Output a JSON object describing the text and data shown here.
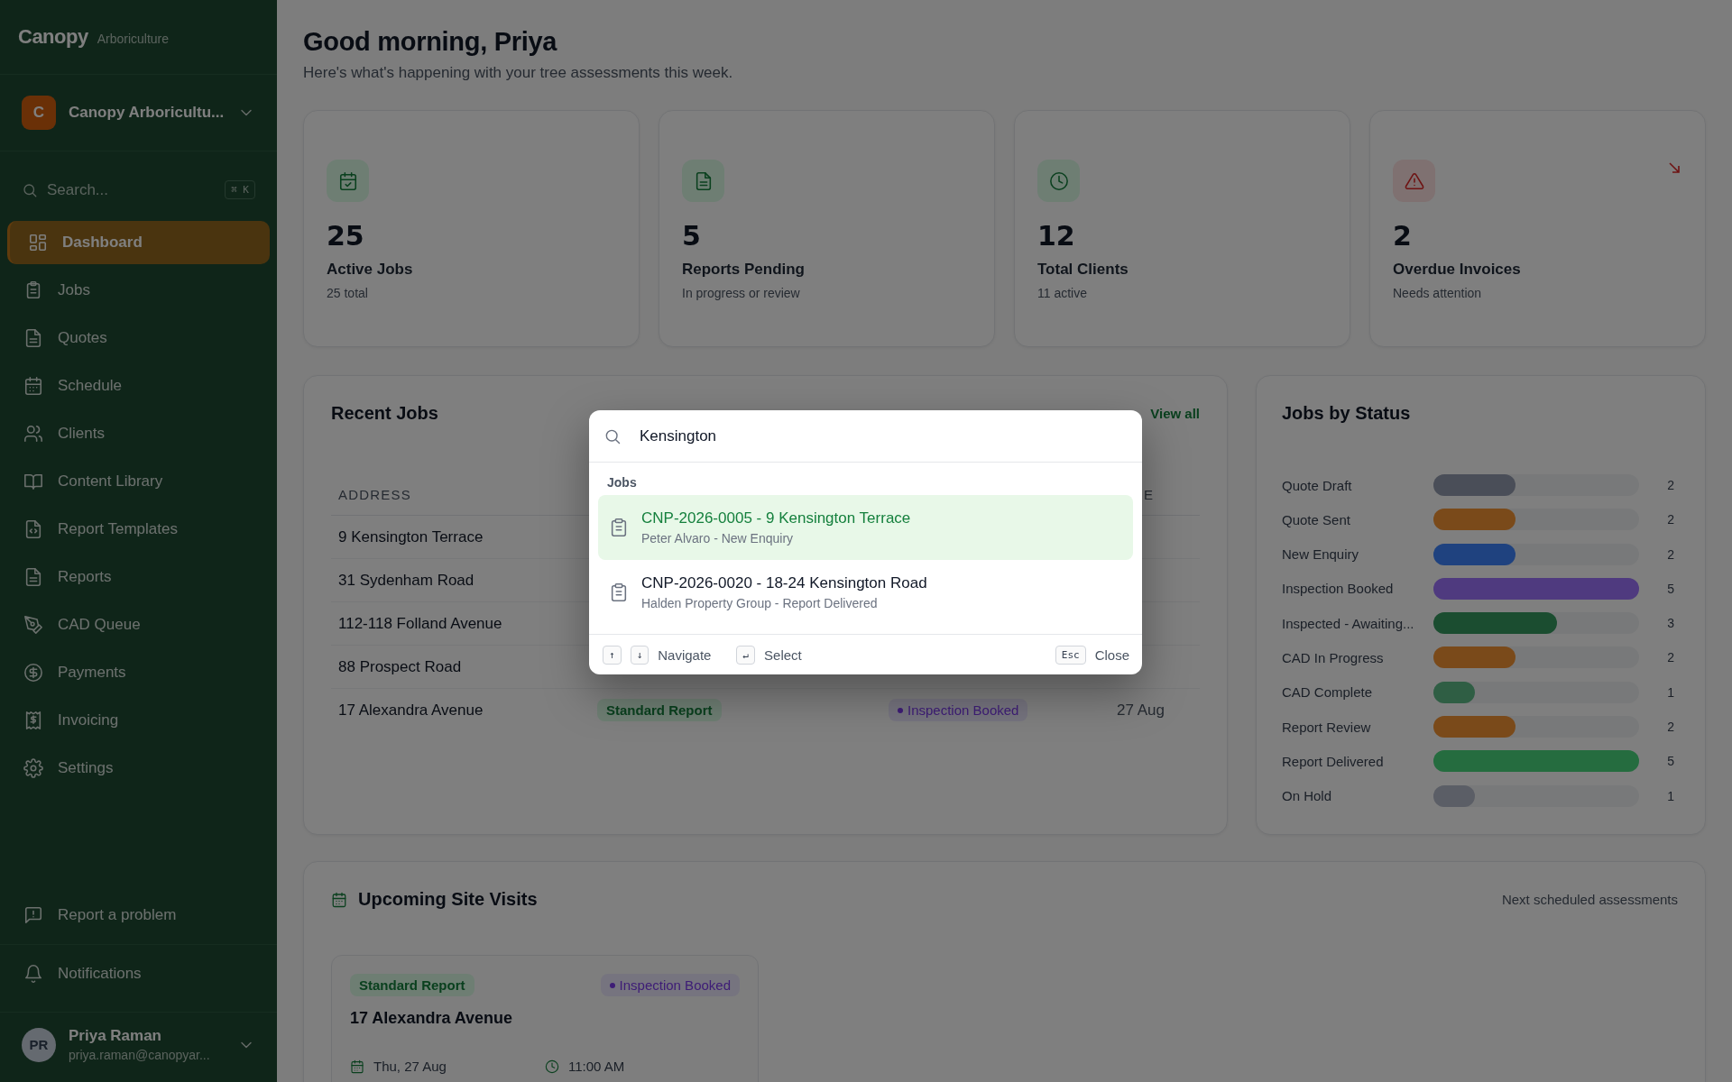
{
  "sidebar": {
    "brand": "Canopy",
    "brand_sub": "Arboriculture",
    "org": {
      "initial": "C",
      "name": "Canopy Arboricultu..."
    },
    "search": {
      "placeholder": "Search...",
      "shortcut": "⌘ K"
    },
    "items": [
      {
        "label": "Dashboard",
        "selected": true
      },
      {
        "label": "Jobs",
        "selected": false
      },
      {
        "label": "Quotes",
        "selected": false
      },
      {
        "label": "Schedule",
        "selected": false
      },
      {
        "label": "Clients",
        "selected": false
      },
      {
        "label": "Content Library",
        "selected": false
      },
      {
        "label": "Report Templates",
        "selected": false
      },
      {
        "label": "Reports",
        "selected": false
      },
      {
        "label": "CAD Queue",
        "selected": false
      },
      {
        "label": "Payments",
        "selected": false
      },
      {
        "label": "Invoicing",
        "selected": false
      },
      {
        "label": "Settings",
        "selected": false
      }
    ],
    "footer_items": [
      {
        "label": "Report a problem"
      },
      {
        "label": "Notifications"
      }
    ],
    "user": {
      "initials": "PR",
      "name": "Priya Raman",
      "email": "priya.raman@canopyar..."
    }
  },
  "header": {
    "title": "Good morning, Priya",
    "subtitle": "Here's what's happening with your tree assessments this week."
  },
  "stats": [
    {
      "kind": "normal",
      "value": "25",
      "label": "Active Jobs",
      "note": "25 total"
    },
    {
      "kind": "normal",
      "value": "5",
      "label": "Reports Pending",
      "note": "In progress or review"
    },
    {
      "kind": "normal",
      "value": "12",
      "label": "Total Clients",
      "note": "11 active"
    },
    {
      "kind": "alert",
      "value": "2",
      "label": "Overdue Invoices",
      "note": "Needs attention"
    }
  ],
  "recent_jobs": {
    "title": "Recent Jobs",
    "link": "View all",
    "columns": [
      "ADDRESS",
      "E"
    ],
    "rows": [
      {
        "address": "9 Kensington Terrace"
      },
      {
        "address": "31 Sydenham Road"
      },
      {
        "address": "112-118 Folland Avenue"
      },
      {
        "address": "88 Prospect Road"
      },
      {
        "address": "17 Alexandra Avenue",
        "type": "Standard Report",
        "status": "Inspection Booked",
        "date": "27 Aug"
      }
    ]
  },
  "jobs_by_status": {
    "title": "Jobs by Status",
    "rows": [
      {
        "label": "Quote Draft",
        "count": "2",
        "level": 0.4,
        "color": "#4a4e58"
      },
      {
        "label": "Quote Sent",
        "count": "2",
        "level": 0.4,
        "color": "#7a4a1a"
      },
      {
        "label": "New Enquiry",
        "count": "2",
        "level": 0.4,
        "color": "#1f427f"
      },
      {
        "label": "Inspection Booked",
        "count": "5",
        "level": 1,
        "color": "#4f3a86"
      },
      {
        "label": "Inspected - Awaiting...",
        "count": "3",
        "level": 0.6,
        "color": "#1b4d30"
      },
      {
        "label": "CAD In Progress",
        "count": "2",
        "level": 0.4,
        "color": "#7a4a1a"
      },
      {
        "label": "CAD Complete",
        "count": "1",
        "level": 0.2,
        "color": "#2f5e44"
      },
      {
        "label": "Report Review",
        "count": "2",
        "level": 0.4,
        "color": "#7a4a1a"
      },
      {
        "label": "Report Delivered",
        "count": "5",
        "level": 1,
        "color": "#256c3f"
      },
      {
        "label": "On Hold",
        "count": "1",
        "level": 0.2,
        "color": "#5b5e66"
      }
    ]
  },
  "upcoming": {
    "title": "Upcoming Site Visits",
    "note": "Next scheduled assessments",
    "visits": [
      {
        "type": "Standard Report",
        "status": "Inspection Booked",
        "address": "17 Alexandra Avenue",
        "date": "Thu, 27 Aug",
        "time": "11:00 AM"
      }
    ]
  },
  "palette": {
    "query": "Kensington",
    "group": "Jobs",
    "results": [
      {
        "title": "CNP-2026-0005 - 9 Kensington Terrace",
        "subtitle": "Peter Alvaro - New Enquiry",
        "selected": true
      },
      {
        "title": "CNP-2026-0020 - 18-24 Kensington Road",
        "subtitle": "Halden Property Group - Report Delivered",
        "selected": false
      }
    ],
    "hints": [
      {
        "keys": [
          "↑",
          "↓"
        ],
        "label": "Navigate"
      },
      {
        "keys": [
          "↵"
        ],
        "label": "Select"
      }
    ],
    "close": {
      "key": "Esc",
      "label": "Close"
    }
  }
}
